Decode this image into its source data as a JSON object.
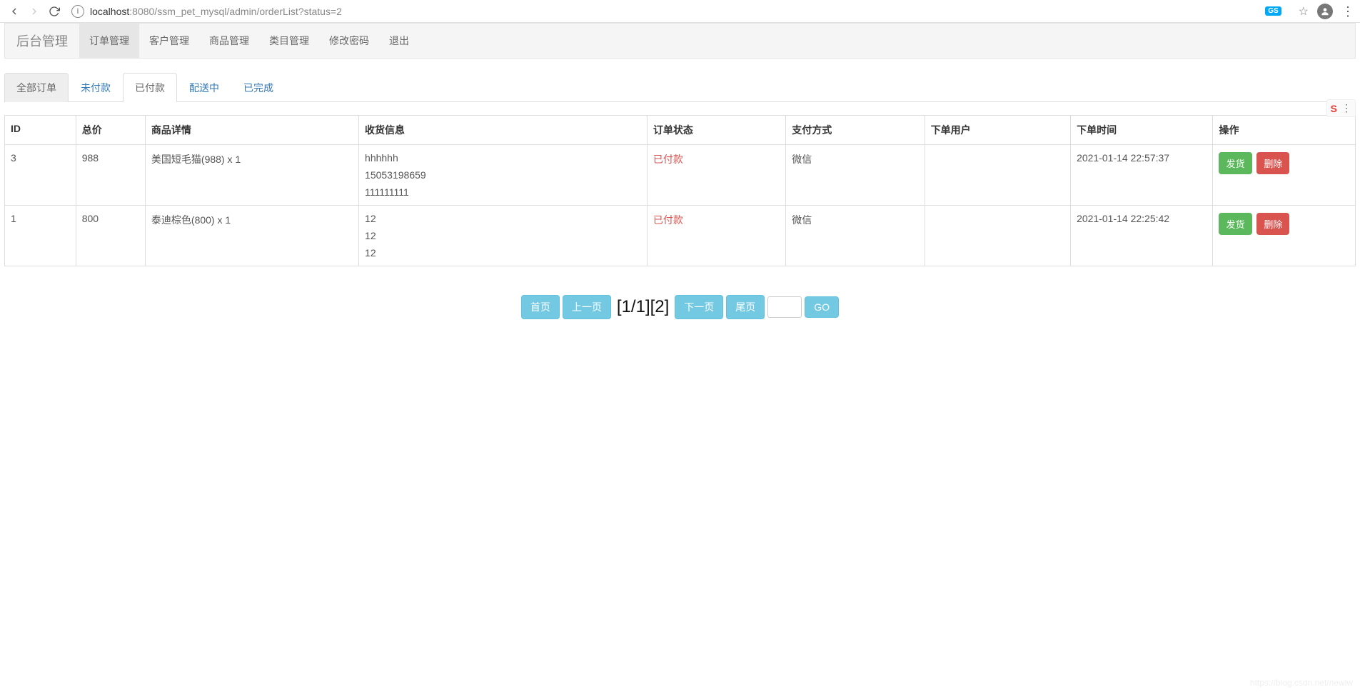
{
  "browser": {
    "url_host": "localhost",
    "url_port_path": ":8080/ssm_pet_mysql/admin/orderList?status=2",
    "ext_badge": "GS",
    "ext_text": ""
  },
  "nav": {
    "brand": "后台管理",
    "items": [
      {
        "label": "订单管理",
        "active": true
      },
      {
        "label": "客户管理",
        "active": false
      },
      {
        "label": "商品管理",
        "active": false
      },
      {
        "label": "类目管理",
        "active": false
      },
      {
        "label": "修改密码",
        "active": false
      },
      {
        "label": "退出",
        "active": false
      }
    ]
  },
  "tabs": [
    {
      "label": "全部订单",
      "state": "grey"
    },
    {
      "label": "未付款",
      "state": "link"
    },
    {
      "label": "已付款",
      "state": "white"
    },
    {
      "label": "配送中",
      "state": "link"
    },
    {
      "label": "已完成",
      "state": "link"
    }
  ],
  "floating_icon": "S",
  "table": {
    "headers": [
      "ID",
      "总价",
      "商品详情",
      "收货信息",
      "订单状态",
      "支付方式",
      "下单用户",
      "下单时间",
      "操作"
    ],
    "rows": [
      {
        "id": "3",
        "total": "988",
        "goods": "美国短毛猫(988) x 1",
        "receive": [
          "hhhhhh",
          "15053198659",
          "111111111"
        ],
        "status": "已付款",
        "pay": "微信",
        "user": "",
        "time": "2021-01-14 22:57:37"
      },
      {
        "id": "1",
        "total": "800",
        "goods": "泰迪棕色(800) x 1",
        "receive": [
          "12",
          "12",
          "12"
        ],
        "status": "已付款",
        "pay": "微信",
        "user": "",
        "time": "2021-01-14 22:25:42"
      }
    ],
    "ship_label": "发货",
    "delete_label": "删除"
  },
  "pagination": {
    "first": "首页",
    "prev": "上一页",
    "info": "[1/1][2]",
    "next": "下一页",
    "last": "尾页",
    "go": "GO"
  },
  "watermark": "https://blog.csdn.net/newlw"
}
